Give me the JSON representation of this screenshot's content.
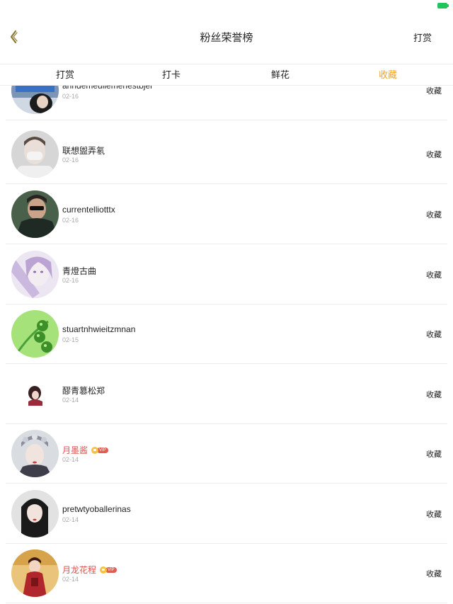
{
  "nav": {
    "title": "粉丝荣誉榜",
    "right": "打赏"
  },
  "tabs": [
    {
      "label": "打赏"
    },
    {
      "label": "打卡"
    },
    {
      "label": "鲜花"
    },
    {
      "label": "收藏"
    }
  ],
  "active_tab": "收藏",
  "rows": [
    {
      "name": "anndemeullemehestbjer",
      "date": "02-16",
      "action": "收藏",
      "vip": false
    },
    {
      "name": "联想盥弄氡",
      "date": "02-16",
      "action": "收藏",
      "vip": false
    },
    {
      "name": "currentelliotttx",
      "date": "02-16",
      "action": "收藏",
      "vip": false
    },
    {
      "name": "青燈古曲",
      "date": "02-16",
      "action": "收藏",
      "vip": false
    },
    {
      "name": "stuartnhwieitzmnan",
      "date": "02-15",
      "action": "收藏",
      "vip": false
    },
    {
      "name": "醪青篡松郑",
      "date": "02-14",
      "action": "收藏",
      "vip": false
    },
    {
      "name": "月墨酱",
      "date": "02-14",
      "action": "收藏",
      "vip": true,
      "vip_label": "VIP"
    },
    {
      "name": "pretwtyoballerinas",
      "date": "02-14",
      "action": "收藏",
      "vip": false
    },
    {
      "name": "月龙花程",
      "date": "02-14",
      "action": "收藏",
      "vip": true,
      "vip_label": "VIP"
    }
  ],
  "colors": {
    "accent": "#f0a429",
    "vip_name": "#d9534f",
    "vip_badge": "#e45b4f",
    "battery": "#21c45a"
  }
}
